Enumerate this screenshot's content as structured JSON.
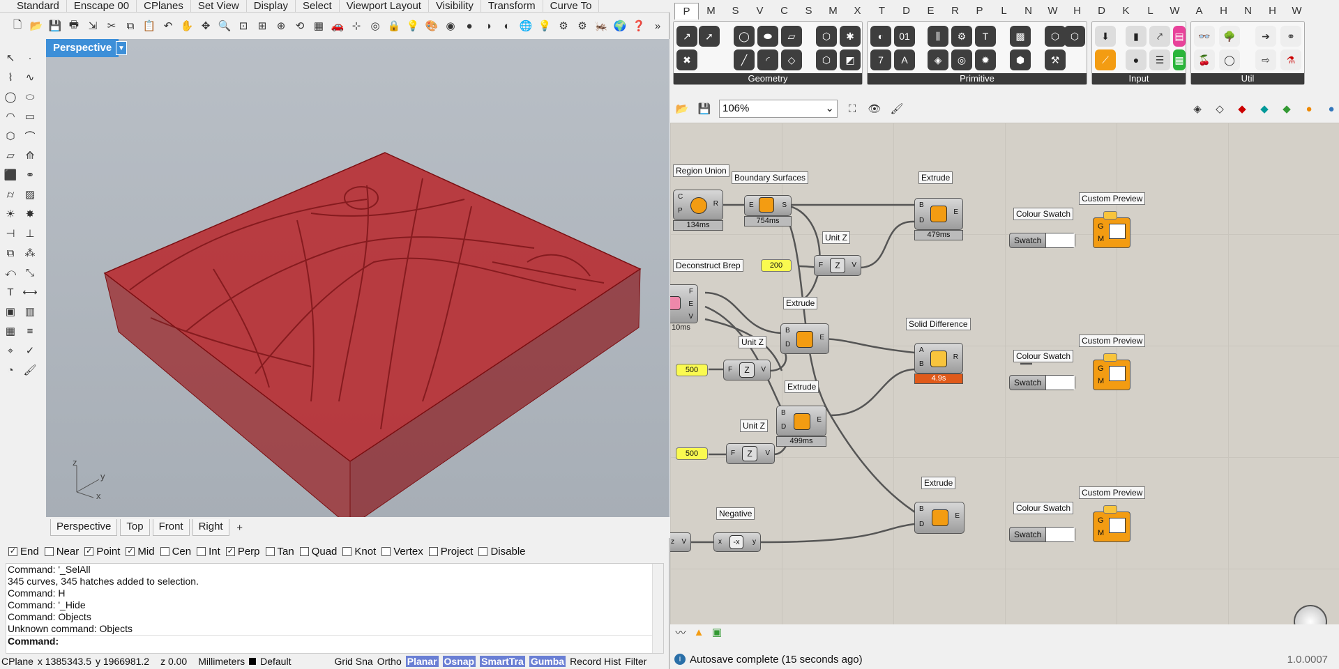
{
  "rhino": {
    "menu_tabs": [
      "Standard",
      "Enscape 00",
      "CPlanes",
      "Set View",
      "Display",
      "Select",
      "Viewport Layout",
      "Visibility",
      "Transform",
      "Curve To"
    ],
    "viewport": {
      "title": "Perspective",
      "axes": {
        "z": "z",
        "y": "y",
        "x": "x"
      }
    },
    "view_tabs": [
      "Perspective",
      "Top",
      "Front",
      "Right"
    ],
    "osnaps": [
      {
        "label": "End",
        "checked": true
      },
      {
        "label": "Near",
        "checked": false
      },
      {
        "label": "Point",
        "checked": true
      },
      {
        "label": "Mid",
        "checked": true
      },
      {
        "label": "Cen",
        "checked": false
      },
      {
        "label": "Int",
        "checked": false
      },
      {
        "label": "Perp",
        "checked": true
      },
      {
        "label": "Tan",
        "checked": false
      },
      {
        "label": "Quad",
        "checked": false
      },
      {
        "label": "Knot",
        "checked": false
      },
      {
        "label": "Vertex",
        "checked": false
      },
      {
        "label": "Project",
        "checked": false
      },
      {
        "label": "Disable",
        "checked": false
      }
    ],
    "command_history": [
      "Command: '_SelAll",
      "345 curves, 345 hatches added to selection.",
      "Command: H",
      "Command: '_Hide",
      "Command: Objects",
      "Unknown command: Objects"
    ],
    "command_prompt": "Command:",
    "status": {
      "cplane": "CPlane",
      "x": "x 1385343.5",
      "y": "y 1966981.2",
      "z": "z 0.00",
      "units": "Millimeters",
      "layer": "Default",
      "grid": "Grid Sna",
      "ortho": "Ortho",
      "planar": "Planar",
      "osnap": "Osnap",
      "smarttrack": "SmartTra",
      "gumball": "Gumba",
      "record": "Record Hist",
      "filter": "Filter"
    }
  },
  "gh": {
    "tabs": [
      "P",
      "M",
      "S",
      "V",
      "C",
      "S",
      "M",
      "X",
      "T",
      "D",
      "E",
      "R",
      "P",
      "L",
      "N",
      "W",
      "H",
      "D",
      "K",
      "L",
      "W",
      "A",
      "H",
      "N",
      "H",
      "W"
    ],
    "ribbon_groups": [
      "Geometry",
      "Primitive",
      "Input",
      "Util"
    ],
    "zoom": "106%",
    "components": {
      "region_union": {
        "tag": "Region Union",
        "time": "134ms",
        "in": [
          "C",
          "P"
        ],
        "out": "R"
      },
      "boundary": {
        "tag": "Boundary Surfaces",
        "time": "754ms",
        "in": "E",
        "out": "S"
      },
      "extrude1": {
        "tag": "Extrude",
        "time": "479ms",
        "in": [
          "B",
          "D"
        ],
        "out": "E"
      },
      "unitz1": {
        "tag": "Unit Z",
        "in": "F",
        "out": "V"
      },
      "num200": "200",
      "deconstruct": {
        "tag": "Deconstruct Brep",
        "time": "10ms",
        "out": [
          "F",
          "E",
          "V"
        ]
      },
      "extrude2": {
        "tag": "Extrude",
        "in": [
          "B",
          "D"
        ],
        "out": "E"
      },
      "solid_diff": {
        "tag": "Solid Difference",
        "time": "4.9s",
        "in": [
          "A",
          "B"
        ],
        "out": "R"
      },
      "unitz2": {
        "tag": "Unit Z",
        "in": "F",
        "out": "V"
      },
      "num500a": "500",
      "extrude3": {
        "tag": "Extrude",
        "time": "499ms",
        "in": [
          "B",
          "D"
        ],
        "out": "E"
      },
      "unitz3": {
        "tag": "Unit Z",
        "in": "F",
        "out": "V"
      },
      "num500b": "500",
      "extrude4": {
        "tag": "Extrude",
        "in": [
          "B",
          "D"
        ],
        "out": "E"
      },
      "negative": {
        "tag": "Negative",
        "in": "x",
        "out": "y"
      },
      "zv": {
        "in": "z",
        "out": "V"
      },
      "swatch": {
        "tag": "Colour Swatch",
        "label": "Swatch"
      },
      "custom_preview": {
        "tag": "Custom Preview",
        "in": [
          "G",
          "M"
        ]
      }
    },
    "status": "Autosave complete (15 seconds ago)",
    "version": "1.0.0007"
  }
}
